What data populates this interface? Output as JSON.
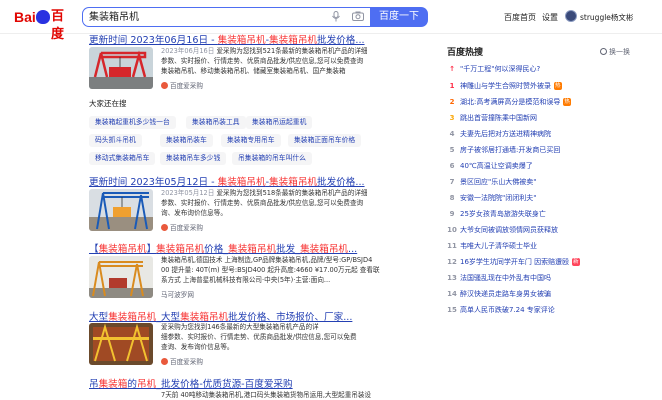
{
  "header": {
    "logo_bai": "Bai",
    "logo_du": "百度",
    "search_value": "集装箱吊机",
    "search_button": "百度一下",
    "links": [
      "百度首页",
      "设置"
    ],
    "username": "struggle杨文彬"
  },
  "results": [
    {
      "title": "更新时间 2023年06月16日 - 集装箱吊机-集装箱吊机批发价格...",
      "title_parts": [
        "更新时间 2023年06月16日 - ",
        "集装箱吊机",
        "-",
        "集装箱吊机",
        "批发价格..."
      ],
      "date": "2023年06月16日",
      "snippet_lines": [
        "爱采购为您找到521条最新的集装箱吊机产品的详细",
        "参数、实时报价、行情走势、优质商品批发/供应信息,您可以免费查询",
        "集装箱吊机、移动集装箱吊机、储藏室集装箱吊机、国产集装箱"
      ],
      "source": "百度爱采购"
    },
    {
      "title": "更新时间 2023年05月12日 - 集装箱吊机-集装箱吊机批发价格...",
      "title_parts": [
        "更新时间 2023年05月12日 - ",
        "集装箱吊机",
        "-",
        "集装箱吊机",
        "批发价格..."
      ],
      "date": "2023年05月12日",
      "snippet_lines": [
        "爱采购为您找到518条最新的集装箱吊机产品的详细",
        "参数、实时报价、行情走势、优质商品批发/供应信息,您可以免费查询",
        "询、发布询价信息等。"
      ],
      "source": "百度爱采购"
    },
    {
      "title": "【集装箱吊机】集装箱吊机价格_集装箱吊机批发_集装箱吊机...",
      "title_parts": [
        "【",
        "集装箱吊机",
        "】",
        "集装箱吊机",
        "价格_",
        "集装箱吊机",
        "批发_",
        "集装箱吊机",
        "..."
      ],
      "snippet_lines": [
        "集装箱吊机,德国技术 上海制造,GP品牌集装箱吊机,品牌/型号:GP/BSJD4",
        "00 提升量: 40T(m) 型号:BSJD400 起升高度:4660 ¥17.00万元起 查看联",
        "系方式 上海普星机械科技有限公司·中央(5年)·主营:面向..."
      ],
      "source": "马可波罗网"
    },
    {
      "title": "大型集装箱吊机_大型集装箱吊机批发价格、市场报价、厂家...",
      "title_parts": [
        "大型",
        "集装箱吊机",
        "_大型",
        "集装箱吊机",
        "批发价格、市场报价、厂家..."
      ],
      "snippet_lines": [
        "爱采购为您找到146条最新的大型集装箱吊机产品的详",
        "细参数、实时报价、行情走势、优质商品批发/供应信息,您可以免费",
        "查询、发布询价信息等。"
      ],
      "source": "百度爱采购"
    },
    {
      "title": "吊集装箱的吊机_批发价格-优质货源-百度爱采购",
      "title_parts": [
        "吊",
        "集装箱",
        "的",
        "吊机",
        "_批发价格-优质货源-百度爱采购"
      ],
      "snippet_lines": [
        "7天前 40吨移动集装箱吊机,港口码头集装箱货物吊运用,大型起重吊装设"
      ]
    }
  ],
  "also_search": {
    "title": "大家还在搜",
    "chips": [
      "集装箱起重机多少钱一台",
      "集装箱吊装工具",
      "集装箱吊运起重机",
      "码头抓斗吊机",
      "集装箱吊装车",
      "集装箱专用吊车",
      "集装箱正面吊车价格",
      "移动式集装箱吊车",
      "集装箱吊车多少钱",
      "吊集装箱的吊车叫什么"
    ]
  },
  "hot": {
    "title": "百度热搜",
    "refresh": "换一换",
    "items": [
      {
        "rank": "",
        "text": "\"千万工程\"何以深得民心?",
        "badge": ""
      },
      {
        "rank": "1",
        "text": "神雕山与学生合照时赞外被录",
        "badge": "热"
      },
      {
        "rank": "2",
        "text": "湖北:高考满屏高分是模范和误导",
        "badge": "热"
      },
      {
        "rank": "3",
        "text": "跳出首营撞陈乘中国新网",
        "badge": ""
      },
      {
        "rank": "4",
        "text": "夫妻先后把对方送进精神病院",
        "badge": ""
      },
      {
        "rank": "5",
        "text": "房子被邻居打通墙:开发商已买回",
        "badge": ""
      },
      {
        "rank": "6",
        "text": "40℃高温让空调卖爆了",
        "badge": ""
      },
      {
        "rank": "7",
        "text": "景区回应\"乐山大佛被卖\"",
        "badge": ""
      },
      {
        "rank": "8",
        "text": "安徽一法院院\"闭闭利夫\"",
        "badge": ""
      },
      {
        "rank": "9",
        "text": "25岁女孩青岛旅游失联身亡",
        "badge": ""
      },
      {
        "rank": "10",
        "text": "大爷女同被调放领情网员获释放",
        "badge": ""
      },
      {
        "rank": "11",
        "text": "韦唯大儿子清华硕士毕业",
        "badge": ""
      },
      {
        "rank": "12",
        "text": "16岁学生坑同学开车门 因索赔遭殴",
        "badge": "新"
      },
      {
        "rank": "13",
        "text": "法国骚乱现在中外乱有中国吗",
        "badge": ""
      },
      {
        "rank": "14",
        "text": "醉汉快递员走路车身男女被骗",
        "badge": ""
      },
      {
        "rank": "15",
        "text": "高单人民币跌破7.24 专家评论",
        "badge": ""
      }
    ]
  },
  "colors": {
    "link": "#2440b3",
    "highlight": "#f73131",
    "brand_blue": "#4e6ef2",
    "logo_red": "#e10602"
  }
}
